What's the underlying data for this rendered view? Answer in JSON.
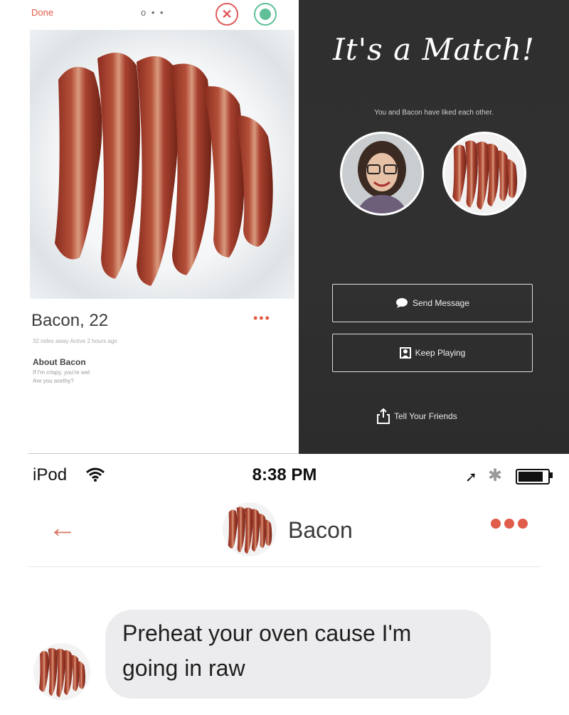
{
  "profile": {
    "done_label": "Done",
    "page_dots": "o • •",
    "name_age": "Bacon, 22",
    "meta": "32 miles away    Active 2 hours ago",
    "about_title": "About Bacon",
    "about_line1": "If I'm crispy, you're wet",
    "about_line2": "Are you worthy?",
    "pass_icon": "✕",
    "more_icon": "•••"
  },
  "match": {
    "title": "It's a Match!",
    "subtitle": "You and Bacon have liked each other.",
    "send_message": "Send Message",
    "keep_playing": "Keep Playing",
    "tell_friends": "Tell Your Friends"
  },
  "status_bar": {
    "carrier": "iPod",
    "time": "8:38 PM",
    "location_icon": "➚",
    "bluetooth_icon": "✱"
  },
  "chat": {
    "back_icon": "←",
    "contact_name": "Bacon",
    "message_line1": "Preheat your oven cause I'm",
    "message_line2": "going in raw"
  },
  "colors": {
    "accent": "#e05c4b",
    "like_green": "#5fbf97",
    "match_bg": "#2f2f2f",
    "bubble_bg": "#ececee"
  }
}
